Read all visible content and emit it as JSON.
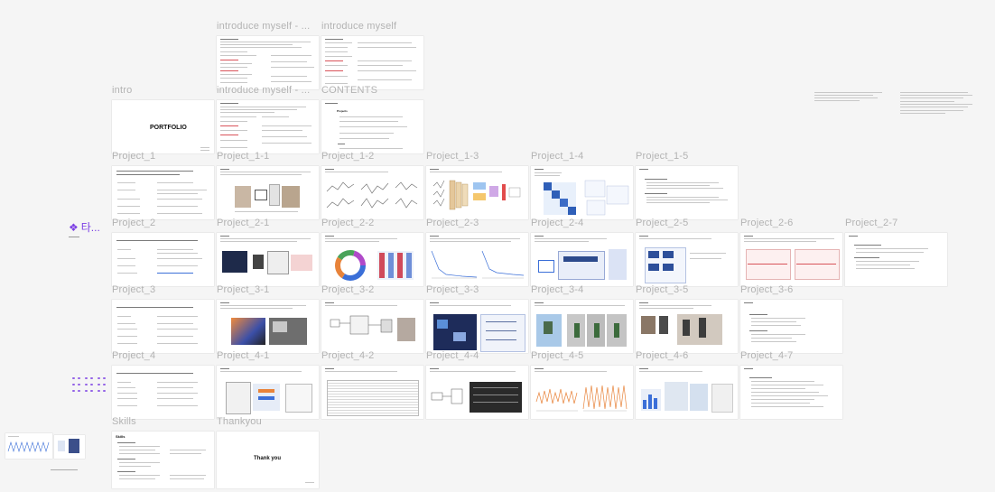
{
  "frames": {
    "introduce_myself_1": "introduce myself - ...",
    "introduce_myself_2": "introduce myself",
    "intro": "intro",
    "introduce_myself_3": "introduce myself - ...",
    "contents": "CONTENTS",
    "project_1": "Project_1",
    "project_1_1": "Project_1-1",
    "project_1_2": "Project_1-2",
    "project_1_3": "Project_1-3",
    "project_1_4": "Project_1-4",
    "project_1_5": "Project_1-5",
    "project_2": "Project_2",
    "project_2_1": "Project_2-1",
    "project_2_2": "Project_2-2",
    "project_2_3": "Project_2-3",
    "project_2_4": "Project_2-4",
    "project_2_5": "Project_2-5",
    "project_2_6": "Project_2-6",
    "project_2_7": "Project_2-7",
    "project_3": "Project_3",
    "project_3_1": "Project_3-1",
    "project_3_2": "Project_3-2",
    "project_3_3": "Project_3-3",
    "project_3_4": "Project_3-4",
    "project_3_5": "Project_3-5",
    "project_3_6": "Project_3-6",
    "project_4": "Project_4",
    "project_4_1": "Project_4-1",
    "project_4_2": "Project_4-2",
    "project_4_4": "Project_4-4",
    "project_4_5": "Project_4-5",
    "project_4_6": "Project_4-6",
    "project_4_7": "Project_4-7",
    "skills": "Skills",
    "thankyou": "Thankyou"
  },
  "slides": {
    "portfolio_title": "PORTFOLIO",
    "thank_you_title": "Thank you",
    "skills_title": "Skills",
    "contents_heading": "Projects"
  },
  "side_widget": {
    "label": "타..."
  },
  "colors": {
    "canvas_bg": "#f5f5f5",
    "frame_bg": "#ffffff",
    "label": "#b3b3b3",
    "accent_purple": "#7b3fe4",
    "accent_red": "#d9535a",
    "accent_blue": "#3b6fd8",
    "accent_orange": "#e8833a"
  }
}
